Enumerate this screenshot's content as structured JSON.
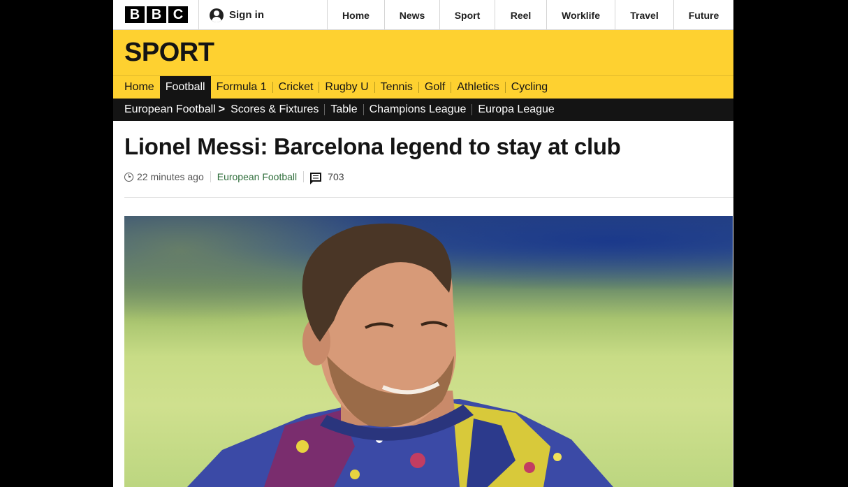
{
  "brand": {
    "logo_letters": [
      "B",
      "B",
      "C"
    ],
    "section_title": "SPORT",
    "accent_color": "#fed130"
  },
  "topbar": {
    "signin_label": "Sign in",
    "nav": [
      "Home",
      "News",
      "Sport",
      "Reel",
      "Worklife",
      "Travel",
      "Future"
    ]
  },
  "sport_nav": {
    "items": [
      "Home",
      "Football",
      "Formula 1",
      "Cricket",
      "Rugby U",
      "Tennis",
      "Golf",
      "Athletics",
      "Cycling"
    ],
    "active": "Football"
  },
  "sub_nav": {
    "parent": "European Football",
    "items": [
      "Scores & Fixtures",
      "Table",
      "Champions League",
      "Europa League"
    ]
  },
  "article": {
    "headline": "Lionel Messi: Barcelona legend to stay at club",
    "time_ago": "22 minutes ago",
    "section_link": "European Football",
    "comment_count": "703"
  }
}
